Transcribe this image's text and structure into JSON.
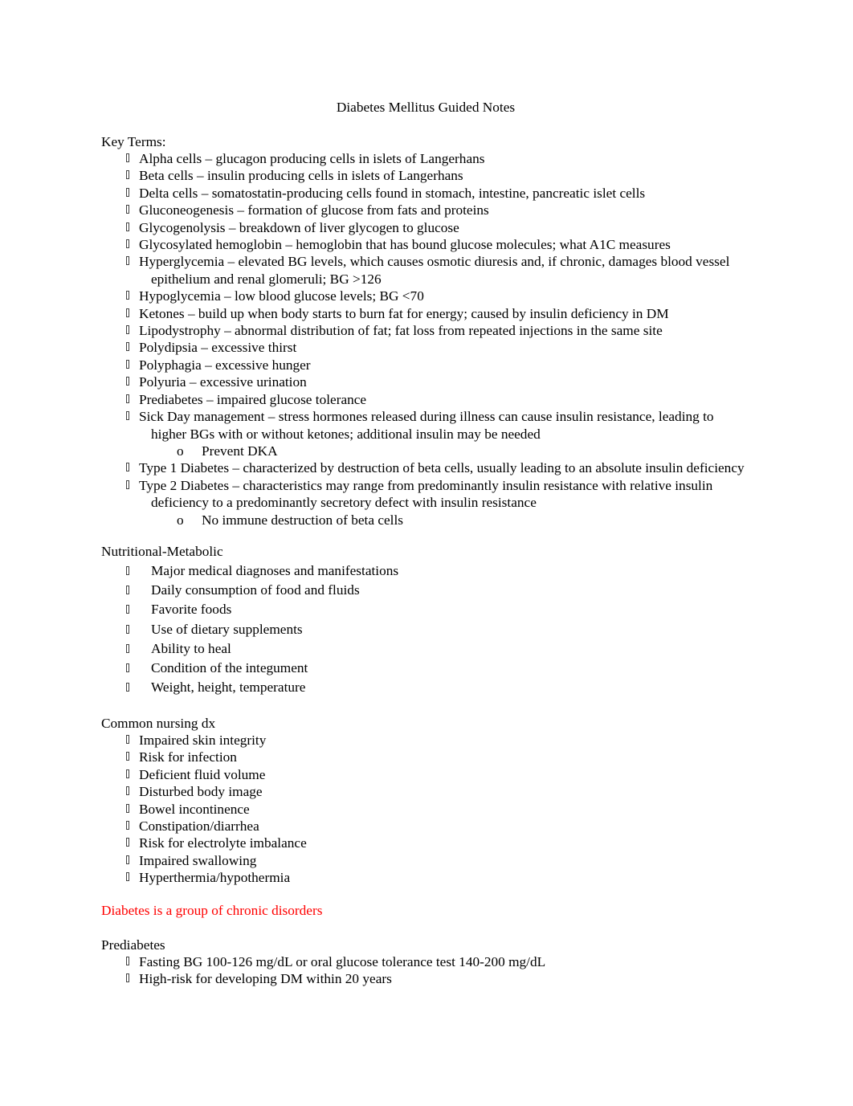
{
  "document": {
    "title": "Diabetes Mellitus Guided Notes",
    "key_terms": {
      "heading": "Key Terms:",
      "items": [
        {
          "text": "Alpha cells – glucagon producing cells in islets of Langerhans"
        },
        {
          "text": "Beta cells – insulin producing cells in islets of Langerhans"
        },
        {
          "text": "Delta cells – somatostatin-producing cells found in stomach, intestine, pancreatic islet cells"
        },
        {
          "text": "Gluconeogenesis  – formation of glucose from fats and proteins"
        },
        {
          "text": "Glycogenolysis – breakdown of liver glycogen to glucose"
        },
        {
          "text": "Glycosylated hemoglobin  – hemoglobin that has bound glucose molecules; what A1C measures"
        },
        {
          "text": "Hyperglycemia – elevated BG levels, which causes osmotic diuresis and, if chronic, damages blood vessel",
          "cont": "epithelium and renal glomeruli; BG >126"
        },
        {
          "text": "Hypoglycemia – low blood glucose levels; BG <70"
        },
        {
          "text": "Ketones – build up when body starts to burn fat for energy; caused by insulin deficiency in DM"
        },
        {
          "text": "Lipodystrophy – abnormal distribution of fat; fat loss from repeated injections in the same site"
        },
        {
          "text": "Polydipsia – excessive thirst"
        },
        {
          "text": "Polyphagia – excessive hunger"
        },
        {
          "text": "Polyuria – excessive urination"
        },
        {
          "text": "Prediabetes  – impaired glucose tolerance"
        },
        {
          "text": "Sick Day management – stress hormones released during illness can cause insulin resistance, leading to",
          "cont": "higher BGs with or without ketones; additional insulin may be needed",
          "sub": "Prevent DKA"
        },
        {
          "text": "Type 1 Diabetes – characterized by destruction of beta cells, usually leading to an absolute insulin deficiency"
        },
        {
          "text": "Type 2 Diabetes – characteristics may range from predominantly insulin resistance with relative insulin",
          "cont": "deficiency to a predominantly secretory defect with insulin resistance",
          "sub": "No immune destruction of beta cells"
        }
      ]
    },
    "nutritional": {
      "heading": "Nutritional-Metabolic",
      "items": [
        "Major medical diagnoses and manifestations",
        "Daily consumption of food and fluids",
        "Favorite foods",
        "Use of dietary supplements",
        "Ability to heal",
        "Condition of the integument",
        "Weight, height, temperature"
      ]
    },
    "nursing_dx": {
      "heading": "Common nursing dx",
      "items": [
        "Impaired skin integrity",
        "Risk for infection",
        "Deficient fluid volume",
        "Disturbed body image",
        "Bowel incontinence",
        "Constipation/diarrhea",
        "Risk for electrolyte imbalance",
        "Impaired swallowing",
        "Hyperthermia/hypothermia"
      ]
    },
    "highlight": {
      "text": "Diabetes is a group of chronic disorders",
      "color": "#ff0000"
    },
    "prediabetes": {
      "heading": "Prediabetes",
      "items": [
        "Fasting BG 100-126 mg/dL or oral glucose tolerance test 140-200 mg/dL",
        "High-risk for developing DM within 20 years"
      ]
    },
    "sub_bullet_glyph": "o"
  }
}
